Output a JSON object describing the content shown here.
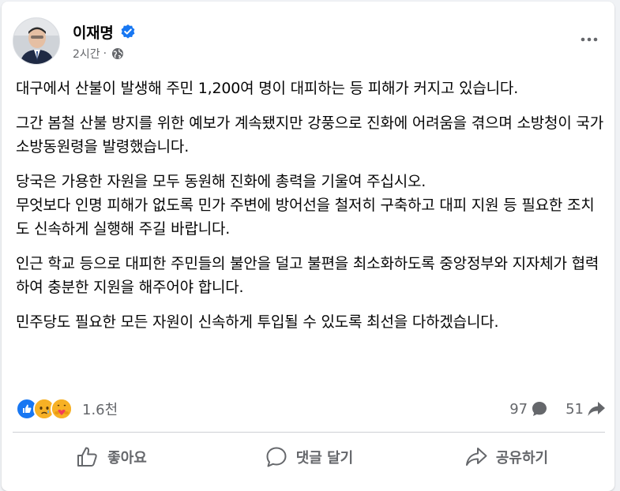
{
  "post": {
    "author": "이재명",
    "time": "2시간",
    "meta_sep": "·",
    "icons": {
      "avatar": "profile-photo",
      "verified": "verified-badge-icon",
      "audience": "globe-icon",
      "more": "more-options-icon"
    },
    "paragraphs": [
      "대구에서 산불이 발생해 주민 1,200여 명이 대피하는 등 피해가 커지고 있습니다.",
      "그간 봄철 산불 방지를 위한 예보가 계속됐지만 강풍으로 진화에 어려움을 겪으며 소방청이 국가소방동원령을 발령했습니다.",
      "당국은 가용한 자원을 모두 동원해 진화에 총력을 기울여 주십시오.\n무엇보다 인명 피해가 없도록 민가 주변에 방어선을 철저히 구축하고 대피 지원 등 필요한 조치도 신속하게 실행해 주길 바랍니다.",
      "인근 학교 등으로 대피한 주민들의 불안을 덜고 불편을 최소화하도록 중앙정부와 지자체가 협력하여 충분한 지원을 해주어야 합니다.",
      "민주당도 필요한 모든 자원이 신속하게 투입될 수 있도록 최선을 다하겠습니다."
    ]
  },
  "stats": {
    "reactions": [
      "like",
      "sad",
      "care"
    ],
    "reaction_count": "1.6천",
    "comment_count": "97",
    "share_count": "51"
  },
  "actions": {
    "like_label": "좋아요",
    "comment_label": "댓글 달기",
    "share_label": "공유하기"
  },
  "colors": {
    "like_blue": "#1877f2",
    "secondary_text": "#65676b",
    "sad_yellow": "#f7b125",
    "care_red": "#f33e58"
  }
}
